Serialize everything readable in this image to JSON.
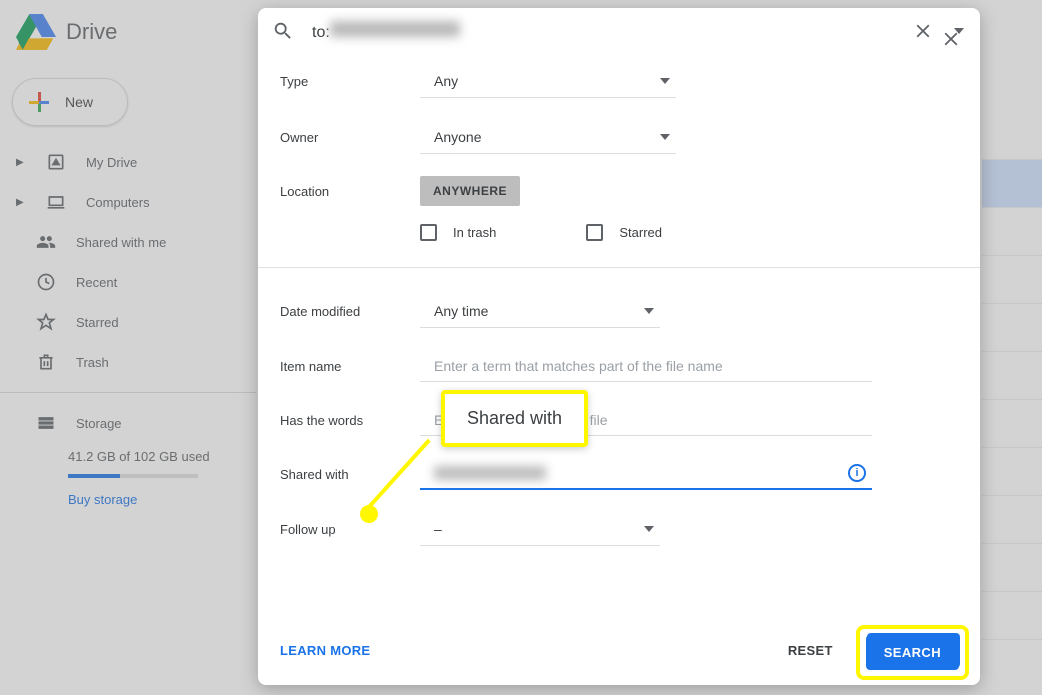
{
  "app": {
    "title": "Drive"
  },
  "sidebar": {
    "new_label": "New",
    "items": [
      {
        "label": "My Drive"
      },
      {
        "label": "Computers"
      },
      {
        "label": "Shared with me"
      },
      {
        "label": "Recent"
      },
      {
        "label": "Starred"
      },
      {
        "label": "Trash"
      }
    ],
    "storage_label": "Storage",
    "storage_usage": "41.2 GB of 102 GB used",
    "buy_label": "Buy storage"
  },
  "search": {
    "prefix": "to:",
    "query_redacted": "████████████"
  },
  "filters": {
    "type_label": "Type",
    "type_value": "Any",
    "owner_label": "Owner",
    "owner_value": "Anyone",
    "location_label": "Location",
    "location_value": "ANYWHERE",
    "in_trash_label": "In trash",
    "starred_label": "Starred",
    "date_label": "Date modified",
    "date_value": "Any time",
    "item_name_label": "Item name",
    "item_name_placeholder": "Enter a term that matches part of the file name",
    "words_label": "Has the words",
    "words_placeholder": "Enter words found in the file",
    "shared_label": "Shared with",
    "shared_value_redacted": "████████",
    "followup_label": "Follow up",
    "followup_value": "–"
  },
  "footer": {
    "learn_more": "LEARN MORE",
    "reset": "RESET",
    "search": "SEARCH"
  },
  "annotation": {
    "callout": "Shared with"
  }
}
